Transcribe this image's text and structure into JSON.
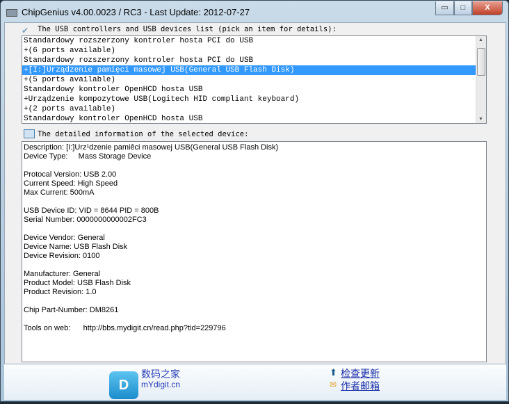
{
  "window": {
    "title": "ChipGenius v4.00.0023 / RC3 - Last Update: 2012-07-27",
    "minimize": "▭",
    "maximize": "□",
    "close": "X"
  },
  "device_list": {
    "label": "The USB controllers and USB devices list (pick an item for details):",
    "items": [
      "Standardowy rozszerzony kontroler hosta PCI do USB",
      "+(6 ports available)",
      "Standardowy rozszerzony kontroler hosta PCI do USB",
      "+[I:]Urządzenie pamięci masowej USB(General USB Flash Disk)",
      "+(5 ports available)",
      "Standardowy kontroler OpenHCD hosta USB",
      "+Urządzenie kompozytowe USB(Logitech HID compliant keyboard)",
      "+(2 ports available)",
      "Standardowy kontroler OpenHCD hosta USB"
    ],
    "selected_index": 3
  },
  "details": {
    "label": "The detailed information of the selected device:",
    "lines": [
      "Description: [I:]Urz¹dzenie pamiêci masowej USB(General USB Flash Disk)",
      "Device Type:     Mass Storage Device",
      "",
      "Protocal Version: USB 2.00",
      "Current Speed: High Speed",
      "Max Current: 500mA",
      "",
      "USB Device ID: VID = 8644 PID = 800B",
      "Serial Number: 0000000000002FC3",
      "",
      "Device Vendor: General",
      "Device Name: USB Flash Disk",
      "Device Revision: 0100",
      "",
      "Manufacturer: General",
      "Product Model: USB Flash Disk",
      "Product Revision: 1.0",
      "",
      "Chip Part-Number: DM8261",
      "",
      "Tools on web:      http://bbs.mydigit.cn/read.php?tid=229796"
    ]
  },
  "footer": {
    "logo_letter": "D",
    "brand_cn": "数码之家",
    "brand_url": "mYdigit.cn",
    "check_update": "检查更新",
    "author_mail": "作者邮箱"
  }
}
